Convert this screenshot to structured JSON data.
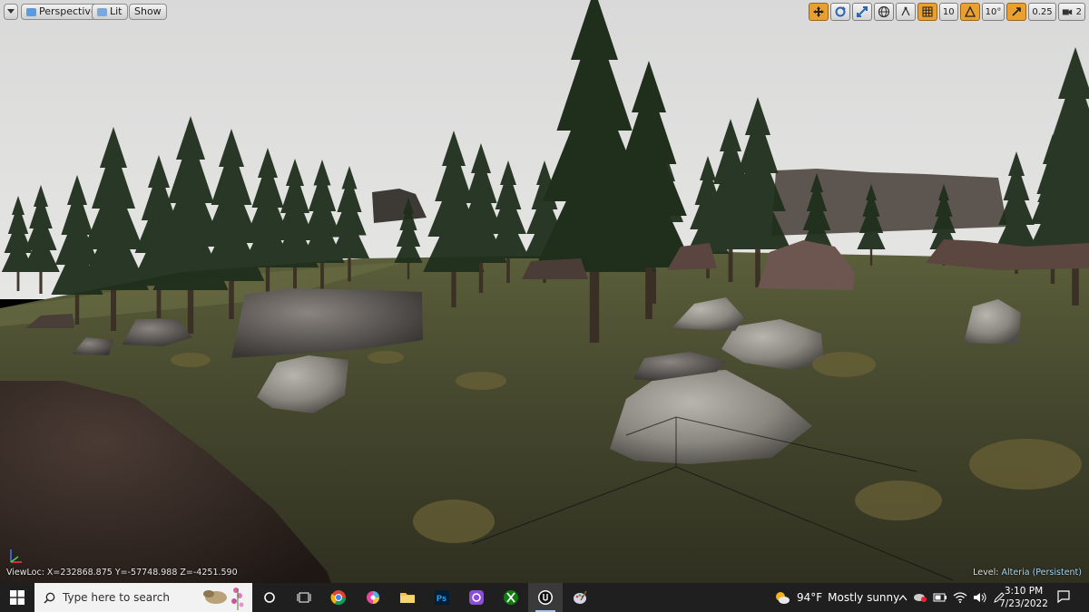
{
  "viewport": {
    "menu_button_icon": "chevron-down-icon",
    "perspective_label": "Perspective",
    "lit_label": "Lit",
    "show_label": "Show",
    "viewloc": "ViewLoc: X=232868.875 Y=-57748.988 Z=-4251.590",
    "level_label": "Level:",
    "level_value": "Alteria (Persistent)"
  },
  "snap_toolbar": {
    "grid_snap_value": "10",
    "rotation_snap_value": "10°",
    "scale_snap_value": "0.25",
    "camera_speed_value": "2"
  },
  "taskbar": {
    "search_placeholder": "Type here to search",
    "weather_temp": "94°F",
    "weather_text": "Mostly sunny",
    "time": "3:10 PM",
    "date": "7/23/2022"
  },
  "colors": {
    "taskbar_bg": "#1f1f1f",
    "snap_active": "#e8a030",
    "level_value": "#9fd6ff"
  }
}
